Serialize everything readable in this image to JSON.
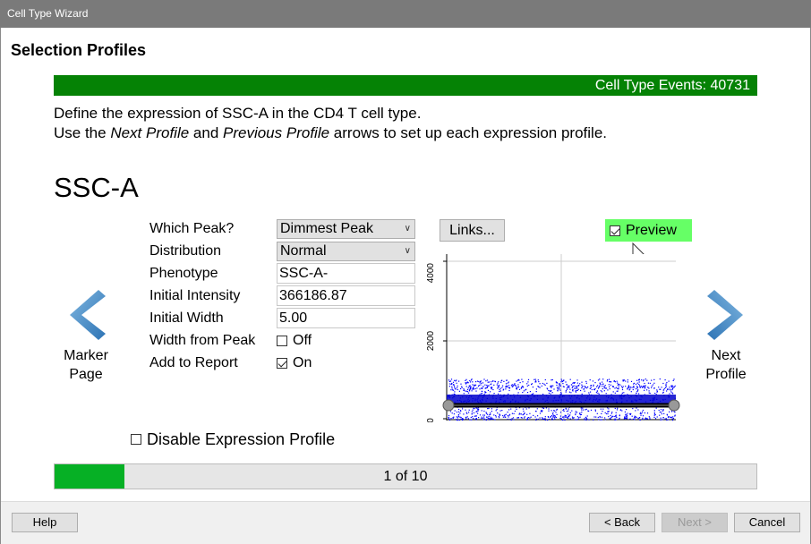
{
  "window": {
    "title": "Cell Type Wizard"
  },
  "page": {
    "section_title": "Selection Profiles"
  },
  "events_bar": {
    "text": "Cell Type Events: 40731",
    "color": "#058205"
  },
  "instructions": {
    "line1": "Define the expression of SSC-A in the CD4 T cell type.",
    "line2_pre": "Use the ",
    "line2_next": "Next Profile",
    "line2_and": " and ",
    "line2_prev": "Previous Profile",
    "line2_post": " arrows to set up each expression profile."
  },
  "parameter": {
    "name": "SSC-A"
  },
  "nav": {
    "left_line1": "Marker",
    "left_line2": "Page",
    "right_line1": "Next",
    "right_line2": "Profile",
    "arrow_icon": "chevron-arrow-icon",
    "arrow_color": "#3a85c2"
  },
  "form": {
    "which_peak_label": "Which Peak?",
    "which_peak_value": "Dimmest Peak",
    "distribution_label": "Distribution",
    "distribution_value": "Normal",
    "phenotype_label": "Phenotype",
    "phenotype_value": "SSC-A-",
    "initial_intensity_label": "Initial Intensity",
    "initial_intensity_value": "366186.87",
    "initial_width_label": "Initial Width",
    "initial_width_value": "5.00",
    "width_from_peak_label": "Width from Peak",
    "width_from_peak_value": "Off",
    "width_from_peak_checked": false,
    "add_to_report_label": "Add to Report",
    "add_to_report_value": "On",
    "add_to_report_checked": true
  },
  "links_button": {
    "label": "Links..."
  },
  "preview": {
    "label": "Preview",
    "checked": true,
    "highlight": "#66ff66"
  },
  "plot": {
    "y_ticks": [
      "4000",
      "2000",
      "0"
    ],
    "y_max": 4200,
    "dot_color": "#0000ff",
    "band_color": "#000000"
  },
  "disable_profile": {
    "label": "Disable Expression Profile",
    "checked": false
  },
  "progress": {
    "text": "1 of 10",
    "current": 1,
    "total": 10,
    "color": "#06b025"
  },
  "footer": {
    "help": "Help",
    "back": "< Back",
    "next": "Next >",
    "cancel": "Cancel"
  }
}
